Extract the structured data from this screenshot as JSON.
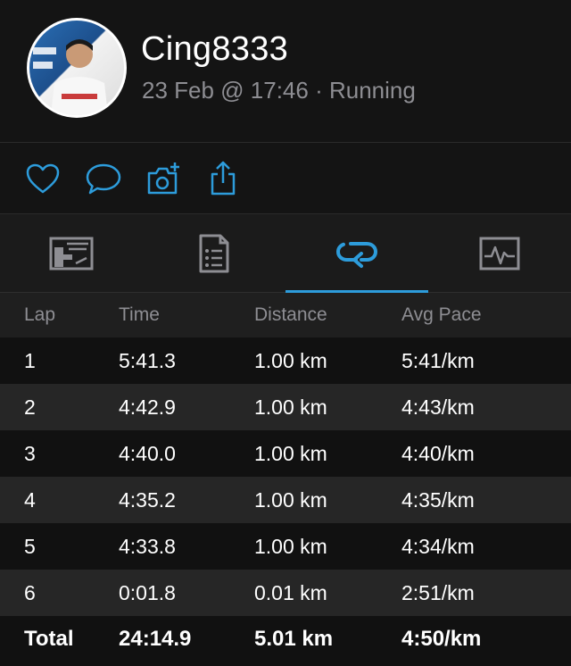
{
  "profile": {
    "username": "Cing8333",
    "meta": "23 Feb @ 17:46 · Running"
  },
  "actions": [
    {
      "icon": "heart-icon"
    },
    {
      "icon": "comment-icon"
    },
    {
      "icon": "camera-add-icon"
    },
    {
      "icon": "share-icon"
    }
  ],
  "tabs": [
    {
      "icon": "map-icon",
      "active": false
    },
    {
      "icon": "details-icon",
      "active": false
    },
    {
      "icon": "laps-icon",
      "active": true
    },
    {
      "icon": "chart-icon",
      "active": false
    }
  ],
  "colors": {
    "accent": "#2d9cdb",
    "muted": "#8e8e93"
  },
  "laps": {
    "headers": [
      "Lap",
      "Time",
      "Distance",
      "Avg Pace"
    ],
    "rows": [
      [
        "1",
        "5:41.3",
        "1.00 km",
        "5:41/km"
      ],
      [
        "2",
        "4:42.9",
        "1.00 km",
        "4:43/km"
      ],
      [
        "3",
        "4:40.0",
        "1.00 km",
        "4:40/km"
      ],
      [
        "4",
        "4:35.2",
        "1.00 km",
        "4:35/km"
      ],
      [
        "5",
        "4:33.8",
        "1.00 km",
        "4:34/km"
      ],
      [
        "6",
        "0:01.8",
        "0.01 km",
        "2:51/km"
      ]
    ],
    "total": [
      "Total",
      "24:14.9",
      "5.01 km",
      "4:50/km"
    ]
  }
}
